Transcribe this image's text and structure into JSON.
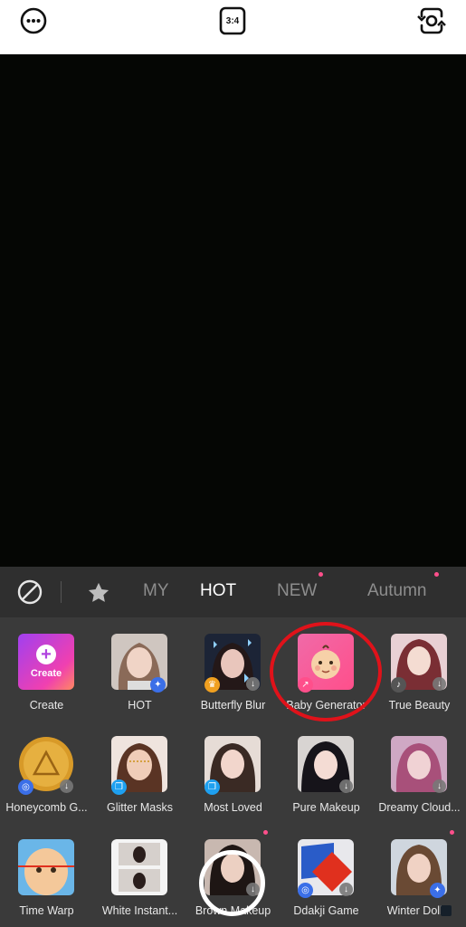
{
  "toolbar": {
    "more_icon": "more-icon",
    "aspect_label": "3:4",
    "switch_camera_icon": "switch-camera-icon"
  },
  "tabs": {
    "items": [
      "MY",
      "HOT",
      "NEW",
      "Autumn"
    ],
    "active": "HOT"
  },
  "filters": [
    {
      "label": "Create",
      "overlay": "Create"
    },
    {
      "label": "HOT"
    },
    {
      "label": "Butterfly Blur"
    },
    {
      "label": "Baby Generator"
    },
    {
      "label": "True Beauty"
    },
    {
      "label": "Honeycomb G..."
    },
    {
      "label": "Glitter Masks"
    },
    {
      "label": "Most Loved"
    },
    {
      "label": "Pure Makeup"
    },
    {
      "label": "Dreamy Cloud..."
    },
    {
      "label": "Time Warp"
    },
    {
      "label": "White Instant..."
    },
    {
      "label": "Brown Makeup"
    },
    {
      "label": "Ddakji Game"
    },
    {
      "label": "Winter Doll..."
    }
  ],
  "colors": {
    "accent_pink": "#ff4f8b",
    "highlight_red": "#e0121a",
    "panel_bg": "#3a3a3a",
    "tabs_bg": "#2f2f2f"
  }
}
